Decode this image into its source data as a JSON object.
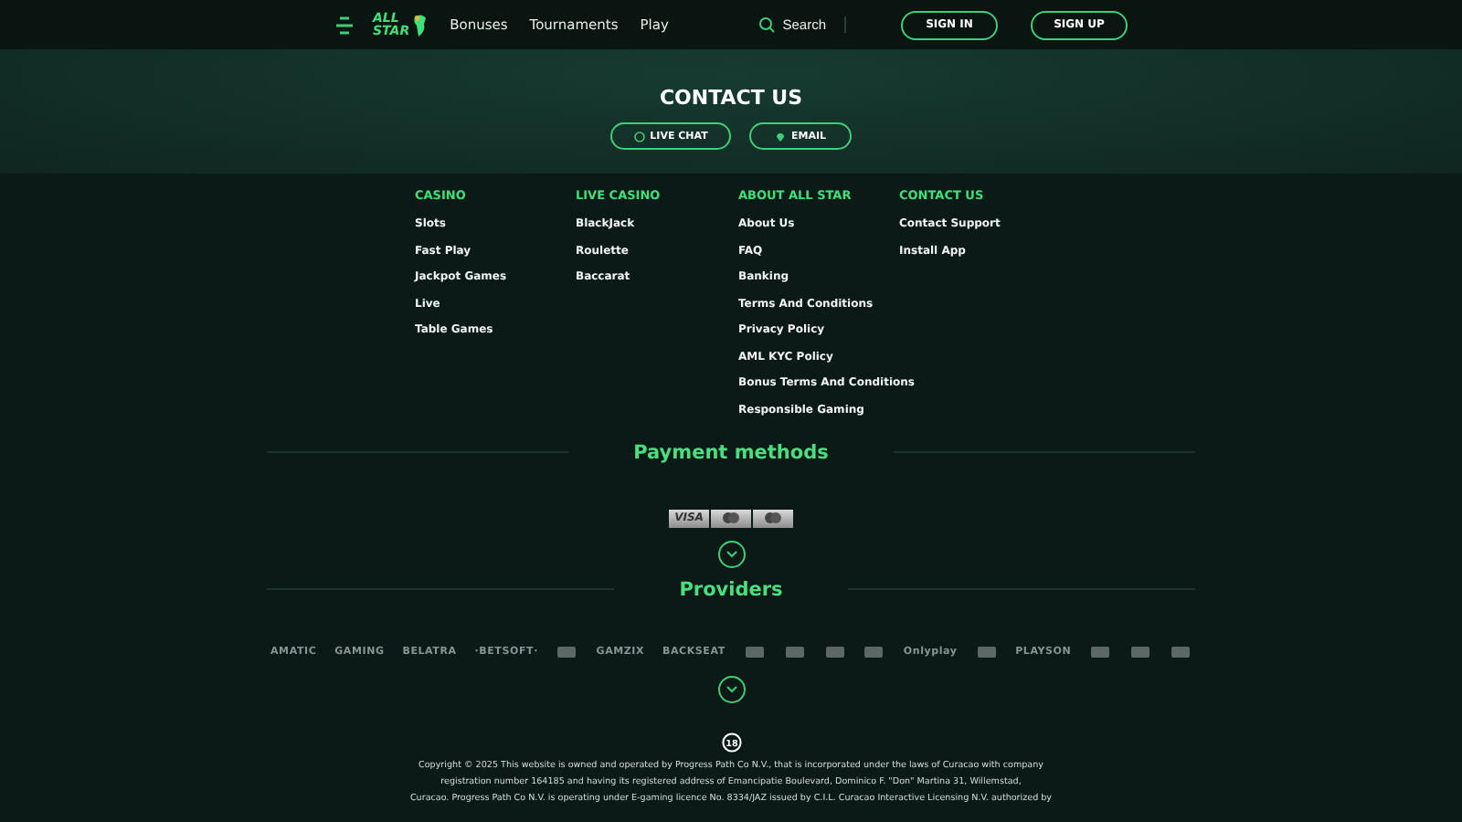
{
  "header": {
    "logo": {
      "line_1": "ALL",
      "line_2": "STAR"
    },
    "nav": [
      "Bonuses",
      "Tournaments",
      "Play"
    ],
    "search": {
      "label": "Search"
    },
    "buttons": [
      "SIGN IN",
      "SIGN UP"
    ]
  },
  "contact": {
    "title": "CONTACT US",
    "buttons": [
      {
        "label": "LIVE CHAT",
        "kind": "chat"
      },
      {
        "label": "EMAIL",
        "kind": "email"
      }
    ]
  },
  "footer_columns": [
    {
      "heading": "CASINO",
      "links": [
        "Slots",
        "Fast Play",
        "Jackpot Games",
        "Live",
        "Table Games"
      ]
    },
    {
      "heading": "LIVE CASINO",
      "links": [
        "BlackJack",
        "Roulette",
        "Baccarat"
      ]
    },
    {
      "heading": "ABOUT ALL STAR",
      "links": [
        "About Us",
        "FAQ",
        "Banking",
        "Terms And Conditions",
        "Privacy Policy",
        "AML KYC Policy",
        "Bonus Terms And Conditions",
        "Responsible Gaming"
      ]
    },
    {
      "heading": "CONTACT US",
      "links": [
        "Contact Support",
        "Install App"
      ]
    }
  ],
  "payment_methods": {
    "title": "Payment methods",
    "cards": [
      {
        "kind": "visa",
        "label": "VISA"
      },
      {
        "kind": "mastercard"
      },
      {
        "kind": "mastercard"
      }
    ]
  },
  "providers": {
    "title": "Providers",
    "logos": [
      {
        "kind": "text",
        "name": "AMATIC"
      },
      {
        "kind": "text",
        "name": "GAMING"
      },
      {
        "kind": "text",
        "name": "BELATRA"
      },
      {
        "kind": "text",
        "name": "·BETSOFT·"
      },
      {
        "kind": "mark"
      },
      {
        "kind": "text",
        "name": "GAMZIX"
      },
      {
        "kind": "text",
        "name": "BACKSEAT"
      },
      {
        "kind": "mark"
      },
      {
        "kind": "mark"
      },
      {
        "kind": "mark"
      },
      {
        "kind": "mark"
      },
      {
        "kind": "text",
        "name": "Onlyplay"
      },
      {
        "kind": "mark"
      },
      {
        "kind": "text",
        "name": "PLAYSON"
      },
      {
        "kind": "mark"
      },
      {
        "kind": "mark"
      },
      {
        "kind": "mark"
      }
    ]
  },
  "age_badge": "18",
  "copyright": [
    "Copyright © 2025 This website is owned and operated by Progress Path Co N.V., that is incorporated under the laws of Curacao with company",
    "registration number 164185 and having its registered address of Emancipatie Boulevard, Dominico F. \"Don\" Martina 31, Willemstad,",
    "Curacao. Progress Path Co N.V. is operating under E-gaming licence No. 8334/JAZ issued by C.I.L. Curacao Interactive Licensing N.V. authorized by"
  ]
}
